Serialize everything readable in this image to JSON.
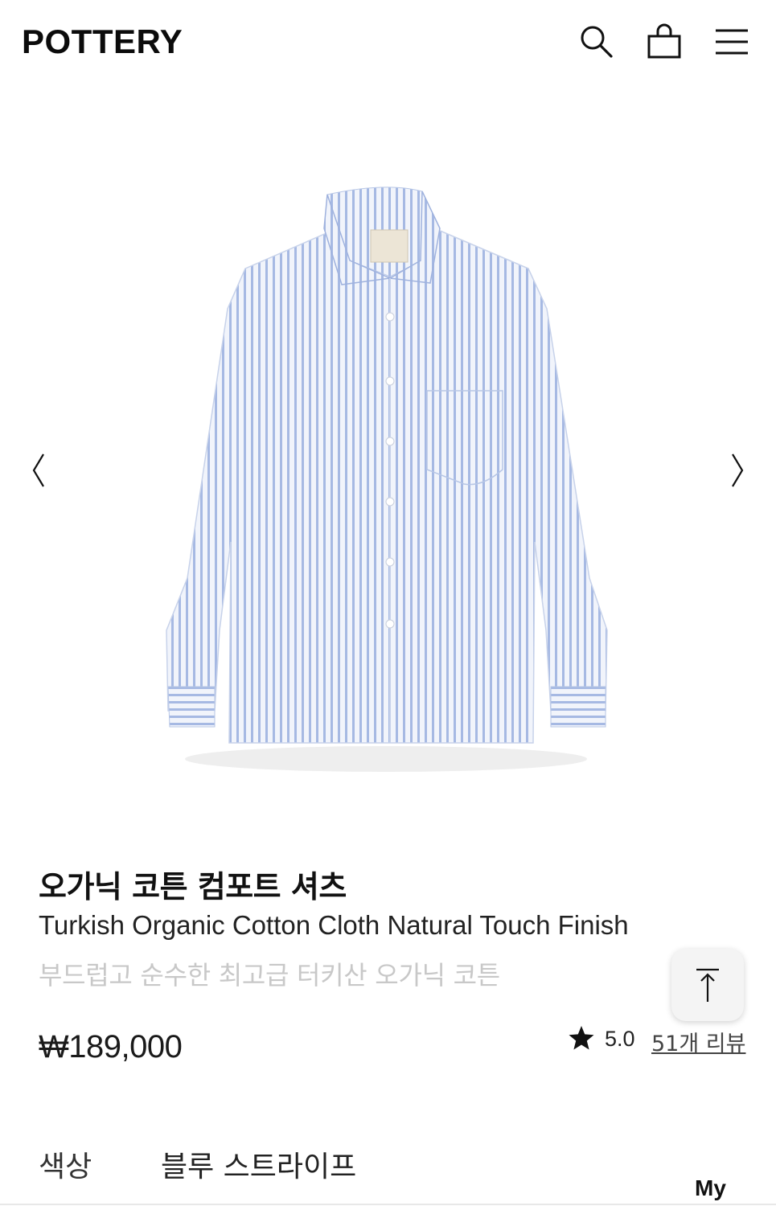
{
  "header": {
    "logo": "POTTERY",
    "icons": [
      "search-icon",
      "shopping-bag-icon",
      "hamburger-menu-icon"
    ]
  },
  "gallery": {
    "image": "light-blue-striped-shirt",
    "prev_icon": "chevron-left-icon",
    "next_icon": "chevron-right-icon"
  },
  "product": {
    "title_ko": "오가닉 코튼 컴포트 셔츠",
    "title_en": "Turkish Organic Cotton Cloth Natural Touch Finish",
    "tagline": "부드럽고 순수한 최고급 터키산 오가닉 코튼",
    "price": "₩189,000",
    "rating": "5.0",
    "review_link": "51개 리뷰"
  },
  "options": {
    "color_label": "색상",
    "color_value": "블루 스트라이프"
  },
  "footer": {
    "my_label": "My"
  },
  "colors": {
    "text_primary": "#111111",
    "tagline": "#c8c8c8",
    "shirt_base": "#eef2fa",
    "shirt_stripe": "#9db2e0"
  }
}
